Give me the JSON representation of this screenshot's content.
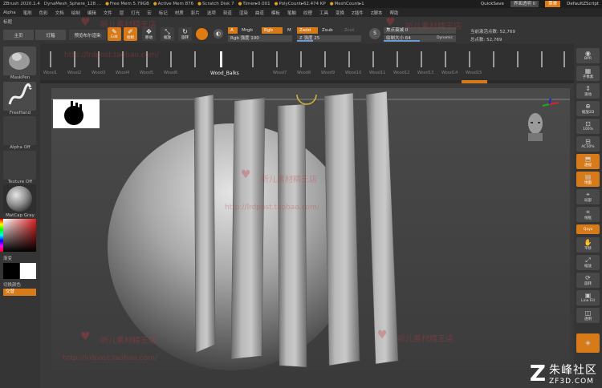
{
  "titlebar": {
    "app": "ZBrush 2020.1.4",
    "file": "DynaMesh_Sphere_128 ...",
    "free_mem": "Free Mem 5.79GB",
    "active_mem": "Active Mem 876",
    "scratch_disk": "Scratch Disk 7",
    "timer": "Timer▸0.001",
    "polycount": "PolyCount▸62.474 KP",
    "meshcount": "MeshCount▸1",
    "quicksave": "QuickSave",
    "transparency": "界面透明 0",
    "menu_btn": "菜单",
    "script": "DefaultZScript"
  },
  "menus": [
    "Alpha",
    "笔刷",
    "色彩",
    "文档",
    "绘制",
    "编辑",
    "文件",
    "层",
    "灯光",
    "宏",
    "标记",
    "材质",
    "影片",
    "选项",
    "刻道",
    "渲染",
    "曲道",
    "模板",
    "笔触",
    "纹理",
    "工具",
    "变换",
    "Z插件",
    "Z脚本",
    "帮助"
  ],
  "sub_label": "标题",
  "toolbar": {
    "home": "主页",
    "lightbox": "灯箱",
    "preview_boolean": "预览布尔渲染",
    "edit": "Edit",
    "draw": "绘制",
    "move": "移动",
    "scale": "缩放",
    "rotate": "旋转",
    "a_label": "A",
    "mrgb": "Mrgb",
    "rgb": "Rgb",
    "m": "M",
    "rgb_intensity": "Rgb 强度 100",
    "zadd": "Zadd",
    "zsub": "Zsub",
    "zcut": "Zcut",
    "z_intensity": "Z 强度 25",
    "focal_shift": "焦点衰减 0",
    "draw_size": "绘制大小 64",
    "dynamic": "Dynamic",
    "active_points": "当前激活点数: 52,769",
    "total_points": "总点数: 52,769",
    "s_icon": "S",
    "z_intensity_value": 25,
    "draw_size_value": 64
  },
  "left_tray": {
    "brush": "MaskPen",
    "stroke": "FreeHand",
    "alpha": "Alpha Off",
    "texture": "Texture Off",
    "material": "MatCap Gray",
    "gradient": "渐变",
    "switch_color": "切换颜色",
    "swap": "交替"
  },
  "brush_strip": {
    "selected": "Wood_Balks",
    "names": [
      "Wood1",
      "Wood2",
      "Wood3",
      "Wood4",
      "Wood5",
      "Wood6",
      "Wood7",
      "Wood8",
      "Wood9",
      "Wood10",
      "Wood11",
      "Wood12",
      "Wood13",
      "Wood14",
      "Wood15"
    ]
  },
  "right_shelf": [
    "BPR",
    "子像素",
    "滚动",
    "缩放2D",
    "100%",
    "AC50%",
    "透视",
    "地面",
    "局部",
    "线框",
    "Qxyz",
    "平移",
    "缩放",
    "旋转",
    "Line Fill",
    "透明"
  ],
  "watermarks": {
    "shop": "听儿素材精王店",
    "url": "http://lrdpost.taobao.com/"
  },
  "logo": {
    "text": "朱峰社区",
    "sub": "ZF3D.COM"
  },
  "colors": {
    "accent": "#d77a19",
    "background": "#2b2b2b"
  }
}
